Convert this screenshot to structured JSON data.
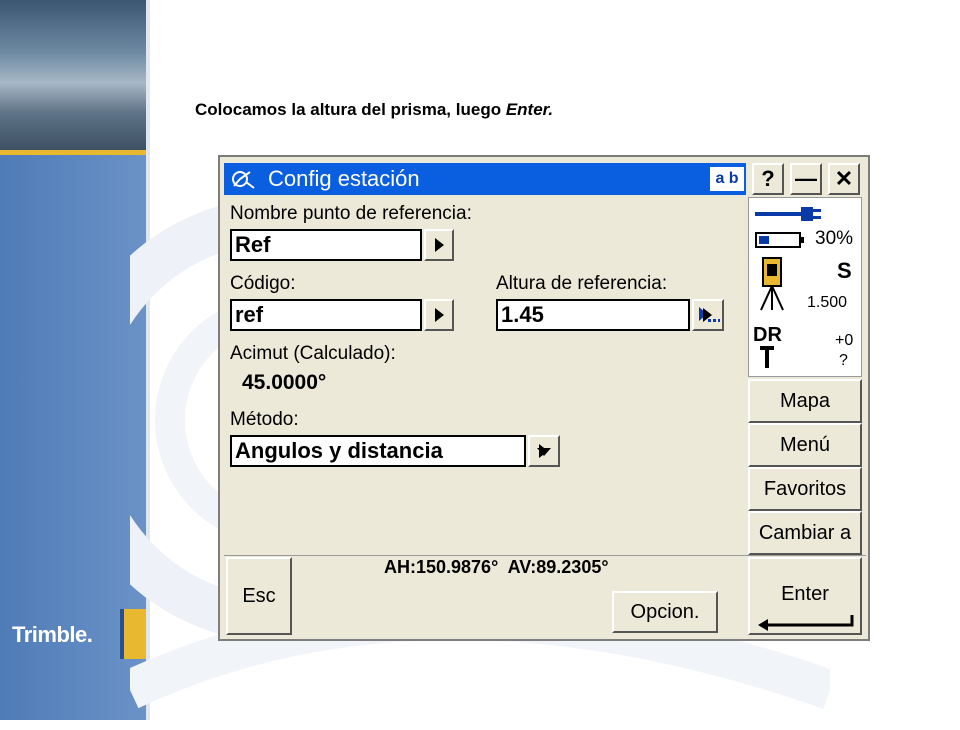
{
  "caption": {
    "text": "Colocamos la altura del prisma, luego ",
    "emph": "Enter."
  },
  "brand": {
    "logo": "Trimble."
  },
  "window": {
    "title": "Config estación",
    "ab_label": "a b",
    "help_label": "?",
    "minimize_label": "—",
    "close_label": "✕"
  },
  "form": {
    "ref_point_label": "Nombre punto de referencia:",
    "ref_point_value": "Ref",
    "code_label": "Código:",
    "code_value": "ref",
    "height_label": "Altura de referencia:",
    "height_value": "1.45",
    "azimuth_label": "Acimut (Calculado):",
    "azimuth_value": "45.0000°",
    "method_label": "Método:",
    "method_value": "Angulos y distancia"
  },
  "status": {
    "battery": "30%",
    "mode": "S",
    "height": "1.500",
    "dr_label": "DR",
    "offset": "+0",
    "unknown": "?"
  },
  "side_buttons": [
    "Mapa",
    "Menú",
    "Favoritos",
    "Cambiar a"
  ],
  "bottom": {
    "esc_label": "Esc",
    "readout": "AH:150.9876°  AV:89.2305°",
    "options_label": "Opcion.",
    "enter_label": "Enter"
  },
  "colors": {
    "titlebar": "#0a5ee0",
    "accent_gold": "#e8b830",
    "panel": "#ece9d8"
  }
}
